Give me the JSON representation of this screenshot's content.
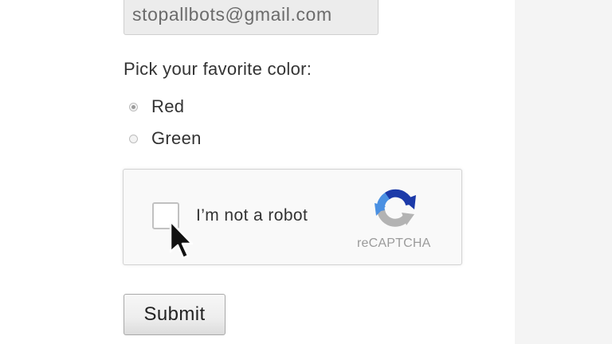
{
  "form": {
    "email_value": "stopallbots@gmail.com",
    "color_question": "Pick your favorite color:",
    "color_options": [
      {
        "label": "Red",
        "selected": true
      },
      {
        "label": "Green",
        "selected": false
      }
    ],
    "submit_label": "Submit"
  },
  "recaptcha": {
    "checkbox_label": "I’m not a robot",
    "brand": "reCAPTCHA",
    "checked": false,
    "colors": {
      "blue_dark": "#1c3aa9",
      "blue_light": "#4a90e2",
      "gray": "#b3b3b3"
    }
  },
  "cursor": {
    "icon": "mouse-pointer-icon"
  }
}
